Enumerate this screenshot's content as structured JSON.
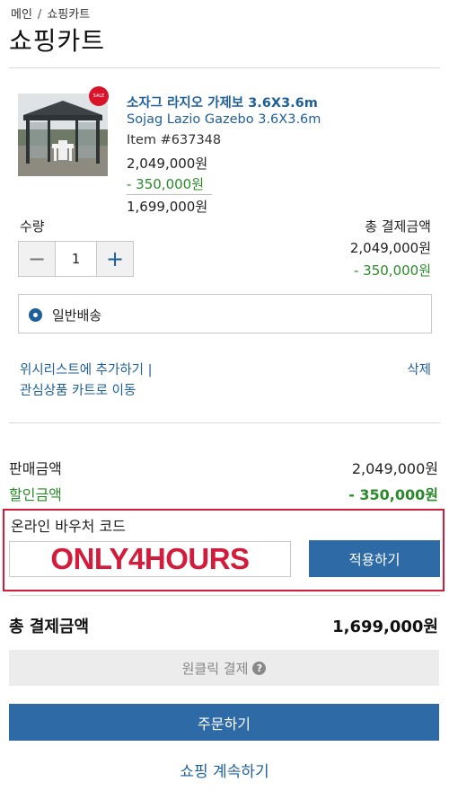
{
  "breadcrumb": {
    "home": "메인",
    "separator": "/",
    "current": "쇼핑카트"
  },
  "page": {
    "title": "쇼핑카트"
  },
  "badge": {
    "text": "SALE"
  },
  "product": {
    "name_ko": "소자그 라지오 가제보 3.6X3.6m",
    "name_en": "Sojag Lazio Gazebo 3.6X3.6m",
    "item_number": "Item #637348",
    "price": "2,049,000원",
    "discount": "- 350,000원",
    "final_price": "1,699,000원",
    "image_icon": "gazebo-photo"
  },
  "quantity": {
    "label": "수량",
    "value": "1",
    "minus_symbol": "−",
    "plus_symbol": "+"
  },
  "line_total": {
    "label": "총 결제금액",
    "original": "2,049,000원",
    "discount": "- 350,000원"
  },
  "shipping": {
    "label": "일반배송",
    "selected": true
  },
  "links": {
    "wishlist": "위시리스트에 추가하기 |",
    "move_to_cart": "관심상품 카트로 이동",
    "delete": "삭제"
  },
  "summary": {
    "sale_label": "판매금액",
    "sale_value": "2,049,000원",
    "discount_label": "할인금액",
    "discount_value": "- 350,000원"
  },
  "voucher": {
    "label": "온라인 바우처 코드",
    "code": "ONLY4HOURS",
    "apply_button": "적용하기"
  },
  "total": {
    "label": "총 결제금액",
    "value": "1,699,000원"
  },
  "buttons": {
    "one_click": "원클릭 결제",
    "order": "주문하기",
    "continue": "쇼핑 계속하기"
  },
  "colors": {
    "accent": "#2e6ba6",
    "link": "#1f5f99",
    "discount": "#2a8a2a",
    "highlight": "#d21c3c"
  }
}
